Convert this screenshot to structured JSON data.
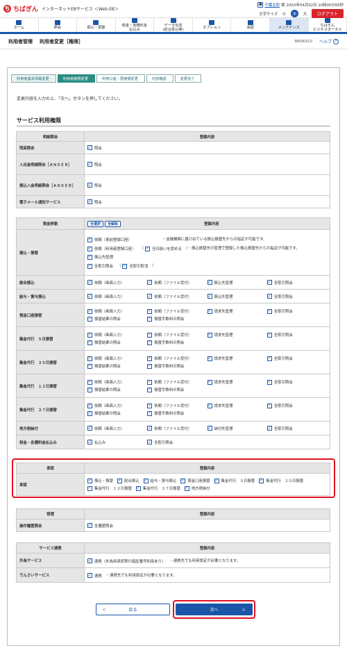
{
  "header": {
    "logo_mark": "ち",
    "logo_text": "ちばぎん",
    "service": "インターネットEBサービス ＜Web-EB＞",
    "user_name": "千葉太郎",
    "honorific": "様",
    "login_time": "20XX年04月02日 10時00分00秒",
    "font_size_label": "文字サイズ",
    "font_small": "小",
    "font_mid": "中",
    "font_large": "大",
    "logout": "ログアウト"
  },
  "gnav": [
    {
      "label": "ホーム"
    },
    {
      "label": "照会"
    },
    {
      "label": "振込・振替"
    },
    {
      "label": "税金・各種料金\n払込み"
    },
    {
      "label": "データ伝送\n(総合振込等)"
    },
    {
      "label": "オプション"
    },
    {
      "label": "承認"
    },
    {
      "label": "メンテナンス"
    },
    {
      "label": "ちばぎん\nビジネスポータル"
    }
  ],
  "page": {
    "title": "利用者管理",
    "subtitle": "利用者変更［権限］",
    "code": "BRSK010",
    "help": "ヘルプ"
  },
  "steps": [
    "利用者基本情報変更",
    "利用者権限変更",
    "利用口座・限度額変更",
    "内容確認",
    "変更完了"
  ],
  "message": "変更内容を入力の上、「次へ」ボタンを押してください。",
  "section_title": "サービス利用権限",
  "inquiry": {
    "h1": "明細照会",
    "h2": "登録内容",
    "rows": [
      {
        "label": "残高照会",
        "opts": [
          "照会"
        ]
      },
      {
        "label": "入出金明細照会［ＡＮＳＥＲ］",
        "opts": [
          "照会"
        ]
      },
      {
        "label": "振込入金明細照会［ＡＮＳＥＲ］",
        "opts": [
          "照会"
        ]
      },
      {
        "label": "電子メール通知サービス",
        "opts": [
          "照会"
        ]
      }
    ]
  },
  "transfer": {
    "h1": "資金移動",
    "select_all": "全選択",
    "clear_all": "全解除",
    "h2": "登録内容",
    "furikomi": {
      "label": "振込・振替",
      "o1": "依頼（事前登録口座）",
      "n1": "・金融機関に届け出ている振込振替先からの指定が可能です。",
      "o2": "依頼（利用者登録口座）",
      "o2b": "当日扱いを認める",
      "n2": "・振込振替先の管理で登録した振込振替先からの指定が可能です。",
      "o3": "振込先管理",
      "o4": "全取引照会",
      "o5": "全取引取消"
    },
    "rows": [
      {
        "label": "総合振込",
        "opts": [
          "依頼（画面入力）",
          "依頼（ファイル受付）",
          "振込先管理",
          "全取引照会"
        ]
      },
      {
        "label": "給与・賞与振込",
        "opts": [
          "依頼（画面入力）",
          "依頼（ファイル受付）",
          "振込先管理",
          "全取引照会"
        ]
      },
      {
        "label": "預金口座振替",
        "opts": [
          "依頼（画面入力）",
          "依頼（ファイル受付）",
          "請求先管理",
          "全取引照会",
          "振替結果の照会",
          "振替手数料の照会"
        ]
      },
      {
        "label": "集金代行　５日振替",
        "opts": [
          "依頼（画面入力）",
          "依頼（ファイル受付）",
          "請求先管理",
          "全取引照会",
          "振替結果の照会",
          "振替手数料の照会"
        ]
      },
      {
        "label": "集金代行　２０日振替",
        "opts": [
          "依頼（画面入力）",
          "依頼（ファイル受付）",
          "請求先管理",
          "全取引照会",
          "振替結果の照会",
          "振替手数料の照会"
        ]
      },
      {
        "label": "集金代行　１２日振替",
        "opts": [
          "依頼（画面入力）",
          "依頼（ファイル受付）",
          "請求先管理",
          "全取引照会",
          "振替結果の照会",
          "振替手数料の照会"
        ]
      },
      {
        "label": "集金代行　２７日振替",
        "opts": [
          "依頼（画面入力）",
          "依頼（ファイル受付）",
          "請求先管理",
          "全取引照会",
          "振替結果の照会",
          "振替手数料の照会"
        ]
      },
      {
        "label": "地方税納付",
        "opts": [
          "依頼（画面入力）",
          "依頼（ファイル受付）",
          "納付先管理",
          "全取引照会"
        ]
      },
      {
        "label": "税金・各種料金払込み",
        "opts": [
          "払込み",
          "全取引照会"
        ]
      }
    ]
  },
  "approval": {
    "h1": "承認",
    "h2": "登録内容",
    "label": "承認",
    "opts": [
      "振込・振替",
      "総合振込",
      "給与・賞与振込",
      "預金口座振替",
      "集金代行　５日振替",
      "集金代行　２０日振替",
      "集金代行　１２日振替",
      "集金代行　２７日振替",
      "地方税納付"
    ]
  },
  "admin": {
    "h1": "管理",
    "h2": "登録内容",
    "label": "操作履歴照会",
    "opt": "全履歴照会"
  },
  "linkage": {
    "h1": "サービス連携",
    "h2": "登録内容",
    "r1_label": "外為サービス",
    "r1_opt": "連携（外為用承認実行暗証番号利用あり）",
    "r1_note": "・連携先でも利用設定が必要となります。",
    "r2_label": "でんさいサービス",
    "r2_opt": "連携",
    "r2_note": "・連携先でも利用設定が必要となります。"
  },
  "buttons": {
    "back": "戻る",
    "next": "次へ",
    "back_arrow": "＜",
    "next_arrow": "＞"
  }
}
